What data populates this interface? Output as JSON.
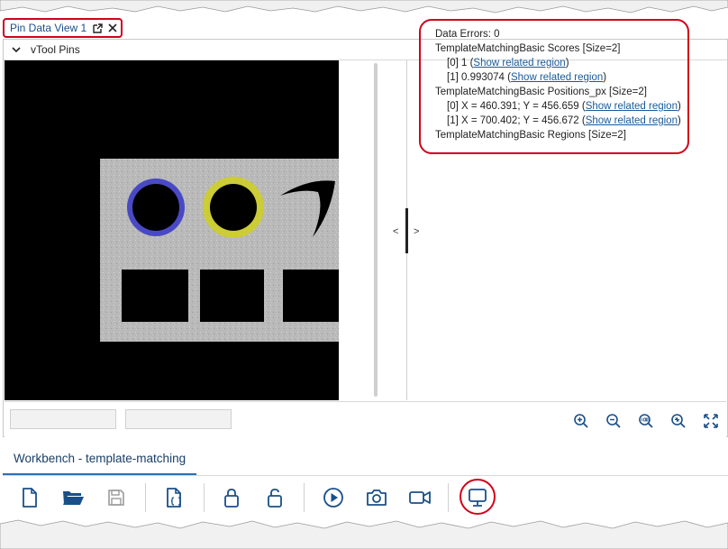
{
  "tab": {
    "label": "Pin Data View 1"
  },
  "panel": {
    "title": "vTool Pins"
  },
  "splitter": {
    "left": "<",
    "right": ">"
  },
  "data_view": {
    "errors": "Data Errors: 0",
    "scores_header": "TemplateMatchingBasic Scores [Size=2]",
    "score0": "[0] 1 (",
    "score1": "[1] 0.993074 (",
    "positions_header": "TemplateMatchingBasic Positions_px [Size=2]",
    "pos0": "[0] X = 460.391; Y = 456.659 (",
    "pos1": "[1] X = 700.402; Y = 456.672 (",
    "regions_header": "TemplateMatchingBasic Regions [Size=2]",
    "link": "Show related region",
    "close_paren": ")"
  },
  "zoom_icons": [
    "zoom-in-icon",
    "zoom-out-icon",
    "zoom-100-icon",
    "zoom-fit-icon",
    "fit-to-window-icon"
  ],
  "workbench": {
    "tab_label": "Workbench - template-matching"
  },
  "toolbar_icons": [
    "new-file-icon",
    "open-folder-icon",
    "save-icon",
    "script-file-icon",
    "lock-icon",
    "unlock-icon",
    "play-icon",
    "camera-icon",
    "video-icon",
    "monitor-icon"
  ],
  "colors": {
    "accent": "#1a4f8a",
    "highlight": "#d0021b",
    "blue_match": "#3a3ad6",
    "yellow_match": "#d8d81e"
  }
}
